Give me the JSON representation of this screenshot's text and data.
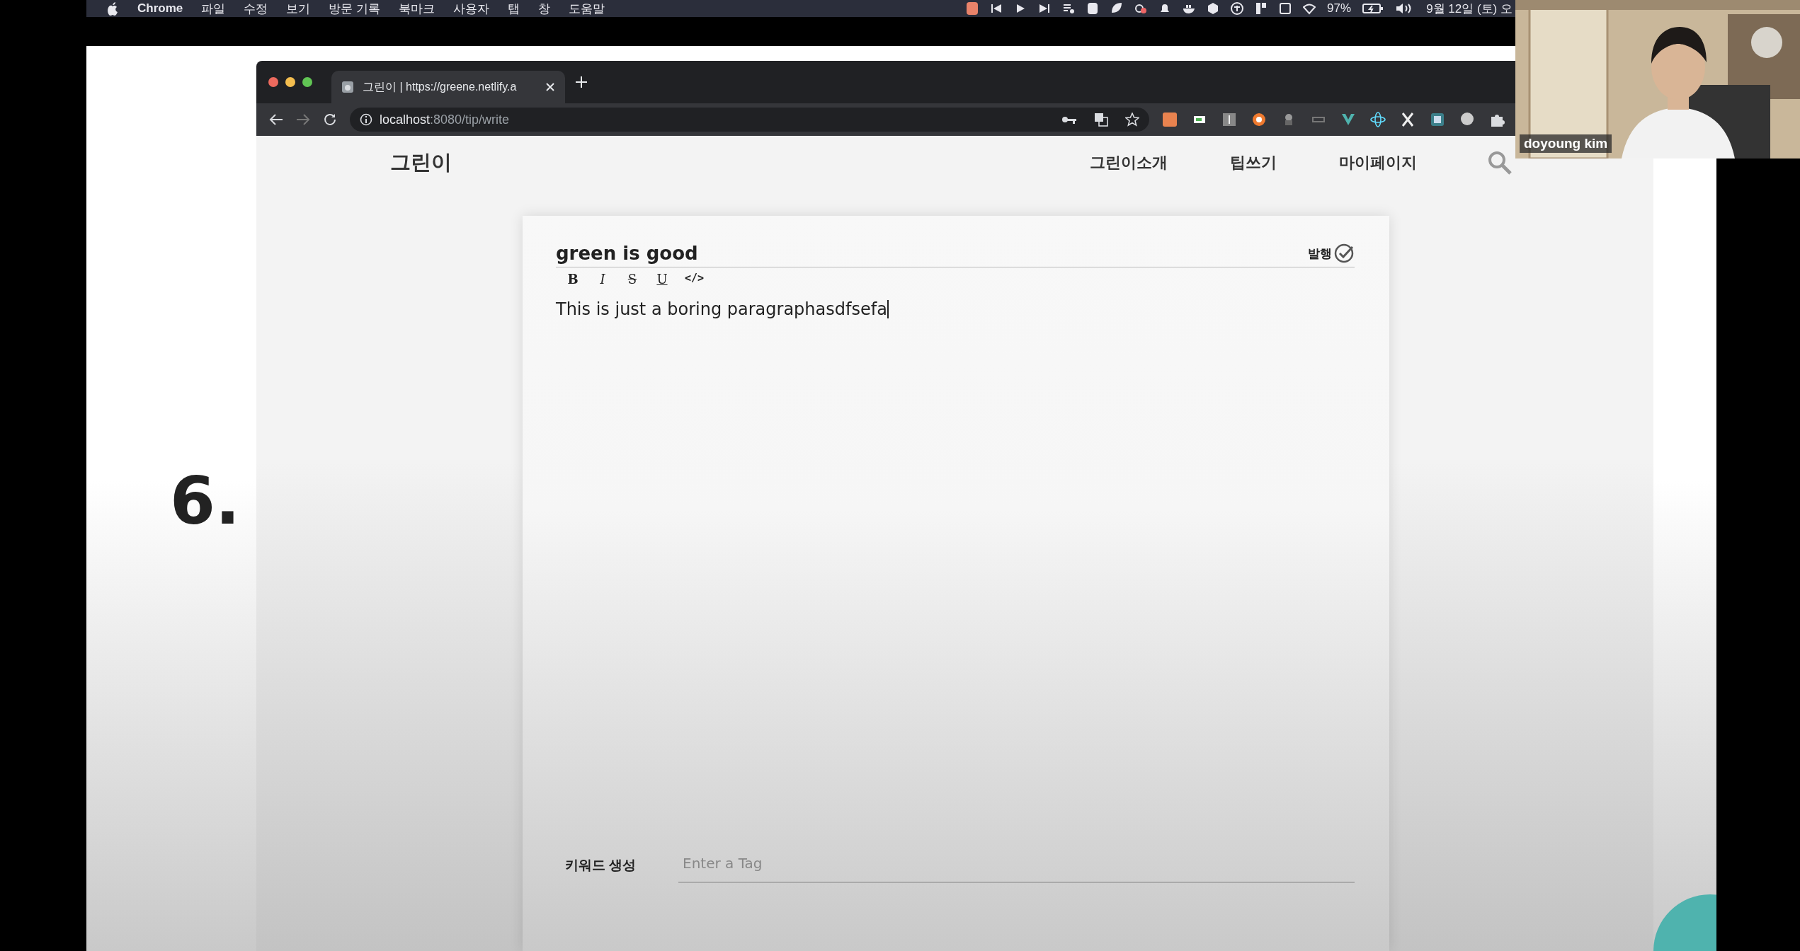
{
  "menu_bar": {
    "app": "Chrome",
    "items": [
      "파일",
      "수정",
      "보기",
      "방문 기록",
      "북마크",
      "사용자",
      "탭",
      "창",
      "도움말"
    ],
    "battery": "97%",
    "clock": "9월 12일 (토) 오"
  },
  "slide": {
    "heading": "6."
  },
  "browser": {
    "tab": {
      "title": "그린이 | https://greene.netlify.a"
    },
    "address": {
      "host": "localhost",
      "path": ":8080/tip/write"
    }
  },
  "site": {
    "logo": "그린이",
    "nav": [
      "그린이소개",
      "팁쓰기",
      "마이페이지"
    ]
  },
  "editor": {
    "title": "green is good",
    "publish": "발행",
    "toolbar": [
      {
        "kind": "bold",
        "label": "B"
      },
      {
        "kind": "italic",
        "label": "I"
      },
      {
        "kind": "strike",
        "label": "S"
      },
      {
        "kind": "underline",
        "label": "U"
      },
      {
        "kind": "code",
        "label": "</>"
      }
    ],
    "body": "This is just a boring paragraphasdfsefa",
    "tag_label": "키워드 생성",
    "tag_input": {
      "placeholder": "Enter a Tag"
    }
  },
  "webcam": {
    "name": "doyoung kim"
  }
}
